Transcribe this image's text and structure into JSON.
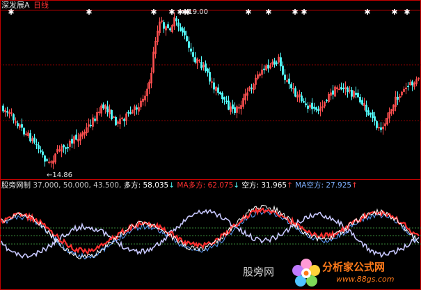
{
  "header": {
    "stock_name": "深发展A",
    "period": "日线"
  },
  "price_panel": {
    "high_label": "19.00",
    "low_label": "14.86",
    "high_marker": "←",
    "low_marker": "←"
  },
  "indicator_panel": {
    "name": "股旁网制",
    "params": "37.000, 50.000, 43.500,",
    "duofang_label": "多方:",
    "duofang_value": "58.035",
    "duofang_arrow": "↓",
    "ma_duofang_label": "MA多方:",
    "ma_duofang_value": "62.075",
    "ma_duofang_arrow": "↓",
    "kongfang_label": "空方:",
    "kongfang_value": "31.965",
    "kongfang_arrow": "↑",
    "ma_kongfang_label": "MA空方:",
    "ma_kongfang_value": "27.925",
    "ma_kongfang_arrow": "↑"
  },
  "watermark": {
    "left_text": "股旁网",
    "brand": "分析家公式网",
    "url": "www.88gs.com"
  },
  "colors": {
    "background": "#000000",
    "separator": "#c00000",
    "up_candle": "#ff5050",
    "down_candle": "#54ffff",
    "duofang": "#ffffff",
    "ma_duofang": "#ff3030",
    "kongfang": "#5fa0ff",
    "ma_kongfang": "#c8c8ff",
    "arrow_up": "#ff4040",
    "arrow_down": "#54ffff",
    "label_text": "#c0c0c0",
    "brand": "#ff7a1a"
  },
  "icons": {
    "signal_marker": "white-diamond-icon"
  }
}
